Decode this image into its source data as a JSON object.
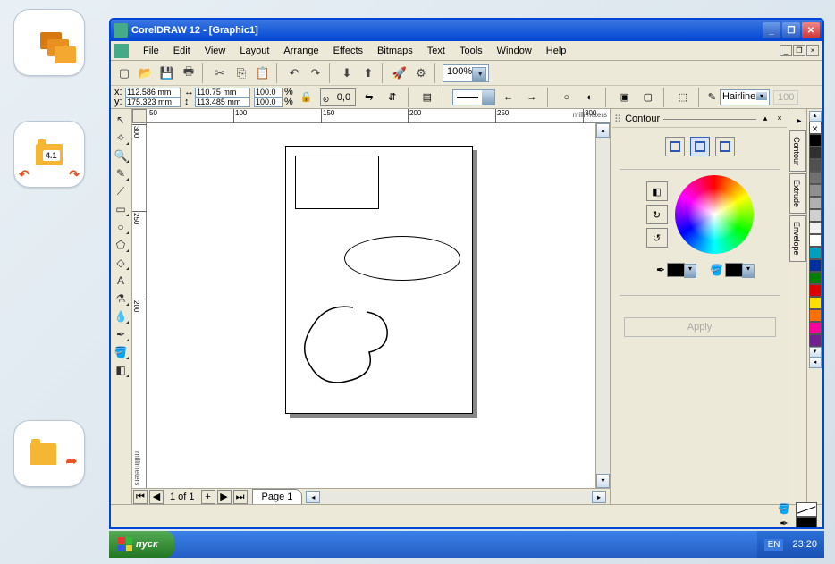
{
  "leftnav": {
    "badge": "4.1"
  },
  "window": {
    "title": "CorelDRAW 12 - [Graphic1]"
  },
  "menu": {
    "items": [
      "File",
      "Edit",
      "View",
      "Layout",
      "Arrange",
      "Effects",
      "Bitmaps",
      "Text",
      "Tools",
      "Window",
      "Help"
    ]
  },
  "toolbar": {
    "zoom": "100%"
  },
  "propbar": {
    "x": "112.586 mm",
    "y": "175.323 mm",
    "w": "110.75 mm",
    "h": "113.485 mm",
    "sx": "100.0",
    "sy": "100.0",
    "pct": "%",
    "rotate": "0,0",
    "hairline": "Hairline",
    "num100": "100"
  },
  "ruler": {
    "hlabels": [
      "50",
      "100",
      "150",
      "200",
      "250",
      "300"
    ],
    "hpos": [
      1,
      97,
      195,
      292,
      390,
      488
    ],
    "unit": "millimeters",
    "vlabels": [
      "300",
      "250",
      "200"
    ],
    "vpos": [
      1,
      98,
      196
    ]
  },
  "pagenav": {
    "info": "1 of 1",
    "tab": "Page 1"
  },
  "docker": {
    "title": "Contour",
    "apply": "Apply",
    "tabs": [
      "Contour",
      "Extrude",
      "Envelope"
    ]
  },
  "palette": {
    "colors": [
      "#ffffff",
      "#00a0c0",
      "#0030a0",
      "#008000",
      "#e00000",
      "#ffe000",
      "#ff7000",
      "#ff00a0",
      "#702090"
    ],
    "grays": [
      "#000000",
      "#303030",
      "#505050",
      "#707070",
      "#909090",
      "#b0b0b0",
      "#d0d0d0",
      "#f0f0f0",
      "#ffffff"
    ]
  },
  "taskbar": {
    "start": "пуск",
    "lang": "EN",
    "clock": "23:20"
  }
}
